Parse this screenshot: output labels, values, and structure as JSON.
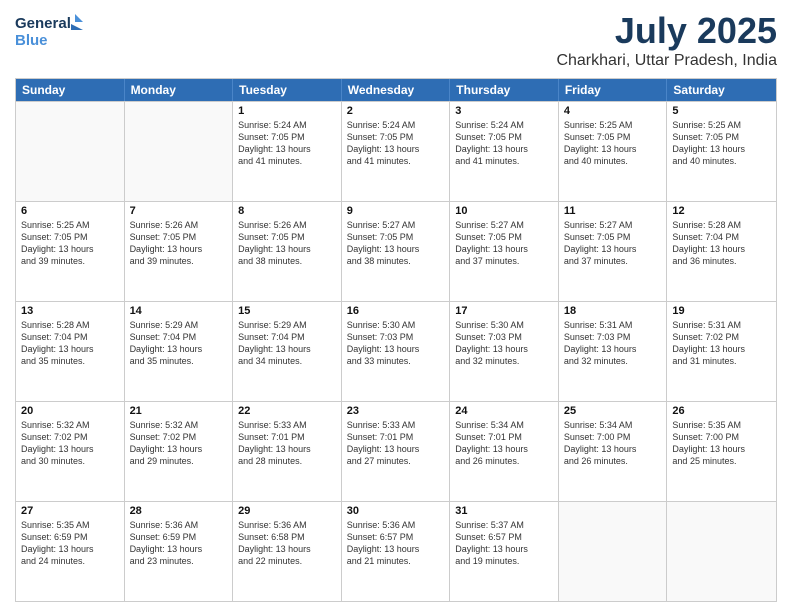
{
  "header": {
    "logo_line1": "General",
    "logo_line2": "Blue",
    "month": "July 2025",
    "location": "Charkhari, Uttar Pradesh, India"
  },
  "weekdays": [
    "Sunday",
    "Monday",
    "Tuesday",
    "Wednesday",
    "Thursday",
    "Friday",
    "Saturday"
  ],
  "rows": [
    [
      {
        "day": "",
        "info": ""
      },
      {
        "day": "",
        "info": ""
      },
      {
        "day": "1",
        "info": "Sunrise: 5:24 AM\nSunset: 7:05 PM\nDaylight: 13 hours\nand 41 minutes."
      },
      {
        "day": "2",
        "info": "Sunrise: 5:24 AM\nSunset: 7:05 PM\nDaylight: 13 hours\nand 41 minutes."
      },
      {
        "day": "3",
        "info": "Sunrise: 5:24 AM\nSunset: 7:05 PM\nDaylight: 13 hours\nand 41 minutes."
      },
      {
        "day": "4",
        "info": "Sunrise: 5:25 AM\nSunset: 7:05 PM\nDaylight: 13 hours\nand 40 minutes."
      },
      {
        "day": "5",
        "info": "Sunrise: 5:25 AM\nSunset: 7:05 PM\nDaylight: 13 hours\nand 40 minutes."
      }
    ],
    [
      {
        "day": "6",
        "info": "Sunrise: 5:25 AM\nSunset: 7:05 PM\nDaylight: 13 hours\nand 39 minutes."
      },
      {
        "day": "7",
        "info": "Sunrise: 5:26 AM\nSunset: 7:05 PM\nDaylight: 13 hours\nand 39 minutes."
      },
      {
        "day": "8",
        "info": "Sunrise: 5:26 AM\nSunset: 7:05 PM\nDaylight: 13 hours\nand 38 minutes."
      },
      {
        "day": "9",
        "info": "Sunrise: 5:27 AM\nSunset: 7:05 PM\nDaylight: 13 hours\nand 38 minutes."
      },
      {
        "day": "10",
        "info": "Sunrise: 5:27 AM\nSunset: 7:05 PM\nDaylight: 13 hours\nand 37 minutes."
      },
      {
        "day": "11",
        "info": "Sunrise: 5:27 AM\nSunset: 7:05 PM\nDaylight: 13 hours\nand 37 minutes."
      },
      {
        "day": "12",
        "info": "Sunrise: 5:28 AM\nSunset: 7:04 PM\nDaylight: 13 hours\nand 36 minutes."
      }
    ],
    [
      {
        "day": "13",
        "info": "Sunrise: 5:28 AM\nSunset: 7:04 PM\nDaylight: 13 hours\nand 35 minutes."
      },
      {
        "day": "14",
        "info": "Sunrise: 5:29 AM\nSunset: 7:04 PM\nDaylight: 13 hours\nand 35 minutes."
      },
      {
        "day": "15",
        "info": "Sunrise: 5:29 AM\nSunset: 7:04 PM\nDaylight: 13 hours\nand 34 minutes."
      },
      {
        "day": "16",
        "info": "Sunrise: 5:30 AM\nSunset: 7:03 PM\nDaylight: 13 hours\nand 33 minutes."
      },
      {
        "day": "17",
        "info": "Sunrise: 5:30 AM\nSunset: 7:03 PM\nDaylight: 13 hours\nand 32 minutes."
      },
      {
        "day": "18",
        "info": "Sunrise: 5:31 AM\nSunset: 7:03 PM\nDaylight: 13 hours\nand 32 minutes."
      },
      {
        "day": "19",
        "info": "Sunrise: 5:31 AM\nSunset: 7:02 PM\nDaylight: 13 hours\nand 31 minutes."
      }
    ],
    [
      {
        "day": "20",
        "info": "Sunrise: 5:32 AM\nSunset: 7:02 PM\nDaylight: 13 hours\nand 30 minutes."
      },
      {
        "day": "21",
        "info": "Sunrise: 5:32 AM\nSunset: 7:02 PM\nDaylight: 13 hours\nand 29 minutes."
      },
      {
        "day": "22",
        "info": "Sunrise: 5:33 AM\nSunset: 7:01 PM\nDaylight: 13 hours\nand 28 minutes."
      },
      {
        "day": "23",
        "info": "Sunrise: 5:33 AM\nSunset: 7:01 PM\nDaylight: 13 hours\nand 27 minutes."
      },
      {
        "day": "24",
        "info": "Sunrise: 5:34 AM\nSunset: 7:01 PM\nDaylight: 13 hours\nand 26 minutes."
      },
      {
        "day": "25",
        "info": "Sunrise: 5:34 AM\nSunset: 7:00 PM\nDaylight: 13 hours\nand 26 minutes."
      },
      {
        "day": "26",
        "info": "Sunrise: 5:35 AM\nSunset: 7:00 PM\nDaylight: 13 hours\nand 25 minutes."
      }
    ],
    [
      {
        "day": "27",
        "info": "Sunrise: 5:35 AM\nSunset: 6:59 PM\nDaylight: 13 hours\nand 24 minutes."
      },
      {
        "day": "28",
        "info": "Sunrise: 5:36 AM\nSunset: 6:59 PM\nDaylight: 13 hours\nand 23 minutes."
      },
      {
        "day": "29",
        "info": "Sunrise: 5:36 AM\nSunset: 6:58 PM\nDaylight: 13 hours\nand 22 minutes."
      },
      {
        "day": "30",
        "info": "Sunrise: 5:36 AM\nSunset: 6:57 PM\nDaylight: 13 hours\nand 21 minutes."
      },
      {
        "day": "31",
        "info": "Sunrise: 5:37 AM\nSunset: 6:57 PM\nDaylight: 13 hours\nand 19 minutes."
      },
      {
        "day": "",
        "info": ""
      },
      {
        "day": "",
        "info": ""
      }
    ]
  ]
}
